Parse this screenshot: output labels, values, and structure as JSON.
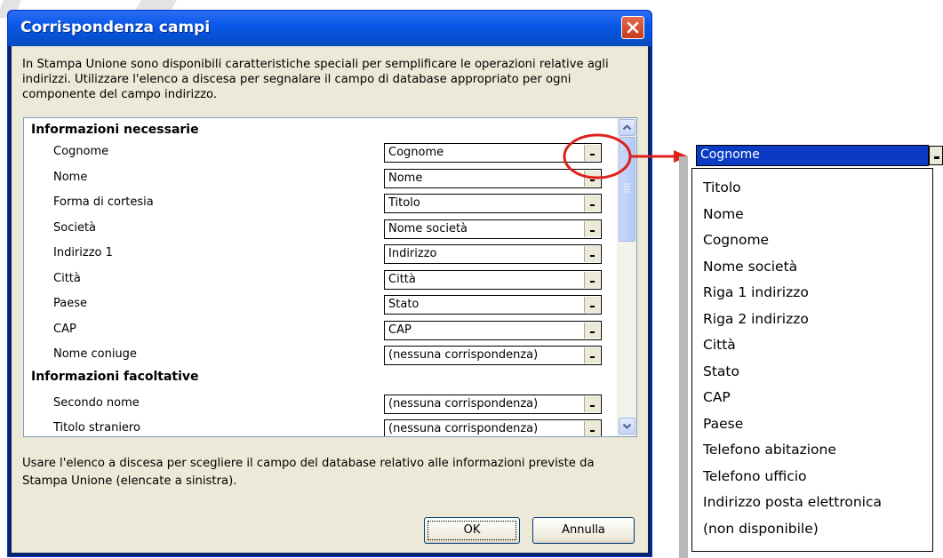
{
  "dialog": {
    "title": "Corrispondenza campi",
    "intro": "In Stampa Unione sono disponibili caratteristiche speciali per semplificare le operazioni relative agli indirizzi. Utilizzare l'elenco a discesa per segnalare il campo di database appropriato per ogni componente del campo indirizzo.",
    "required_heading": "Informazioni necessarie",
    "optional_heading": "Informazioni facoltative",
    "required_fields": [
      {
        "label": "Cognome",
        "value": "Cognome"
      },
      {
        "label": "Nome",
        "value": "Nome"
      },
      {
        "label": "Forma di cortesia",
        "value": "Titolo"
      },
      {
        "label": "Società",
        "value": "Nome società"
      },
      {
        "label": "Indirizzo 1",
        "value": "Indirizzo"
      },
      {
        "label": "Città",
        "value": "Città"
      },
      {
        "label": "Paese",
        "value": "Stato"
      },
      {
        "label": "CAP",
        "value": "CAP"
      },
      {
        "label": "Nome coniuge",
        "value": "(nessuna corrispondenza)"
      }
    ],
    "optional_fields": [
      {
        "label": "Secondo nome",
        "value": "(nessuna corrispondenza)"
      },
      {
        "label": "Titolo straniero",
        "value": "(nessuna corrispondenza)"
      }
    ],
    "footer_text": "Usare l'elenco a discesa per scegliere il campo del database relativo alle informazioni previste da Stampa Unione (elencate a sinistra).",
    "ok_label": "OK",
    "cancel_label": "Annulla"
  },
  "dropdown": {
    "selected": "Cognome",
    "options": [
      "Titolo",
      "Nome",
      "Cognome",
      "Nome società",
      "Riga 1 indirizzo",
      "Riga 2 indirizzo",
      "Città",
      "Stato",
      "CAP",
      "Paese",
      "Telefono abitazione",
      "Telefono ufficio",
      "Indirizzo posta elettronica",
      "(non disponibile)"
    ]
  },
  "colors": {
    "annotation": "#e0201a",
    "selection": "#0a3bc2"
  }
}
